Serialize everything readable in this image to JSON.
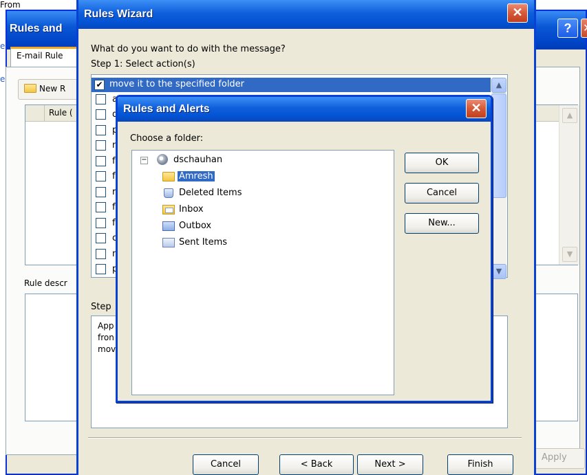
{
  "background": {
    "from_label": "From",
    "edge_letters": [
      "e",
      "e"
    ]
  },
  "back_window": {
    "title": "Rules and",
    "help_glyph": "?",
    "close_glyph": "✕",
    "tab_label": "E-mail Rule",
    "new_rule_label": "New R",
    "rule_column": "Rule (",
    "rule_description_label": "Rule descr",
    "apply_label": "Apply",
    "colors": {
      "title_bar": "#0a58d6",
      "tab_accent": "#f4a926"
    }
  },
  "wizard": {
    "title": "Rules Wizard",
    "close_glyph": "✕",
    "question": "What do you want to do with the message?",
    "step1": "Step 1: Select action(s)",
    "selected_action": "move it to the specified folder",
    "selected_checked": true,
    "partial_actions": [
      "a",
      "d",
      "p",
      "m",
      "fc",
      "fc",
      "re",
      "fl",
      "fl",
      "cl",
      "m",
      "p"
    ],
    "step2": "Step",
    "description_lines": [
      "App",
      "fron",
      "mov"
    ],
    "buttons": {
      "cancel": "Cancel",
      "back": "< Back",
      "next": "Next >",
      "finish": "Finish"
    },
    "colors": {
      "selection": "#316ac5",
      "border": "#0841d4"
    }
  },
  "folder_dialog": {
    "title": "Rules and Alerts",
    "close_glyph": "✕",
    "prompt": "Choose a folder:",
    "tree": {
      "root": {
        "label": "dschauhan",
        "icon": "mailbox-icon",
        "expanded": true,
        "toggle": "−"
      },
      "children": [
        {
          "label": "Amresh",
          "icon": "folder-icon",
          "selected": true
        },
        {
          "label": "Deleted Items",
          "icon": "deleted-items-icon",
          "selected": false
        },
        {
          "label": "Inbox",
          "icon": "inbox-icon",
          "selected": false
        },
        {
          "label": "Outbox",
          "icon": "outbox-icon",
          "selected": false
        },
        {
          "label": "Sent Items",
          "icon": "sent-items-icon",
          "selected": false
        }
      ]
    },
    "buttons": {
      "ok": "OK",
      "cancel": "Cancel",
      "new": "New..."
    }
  }
}
